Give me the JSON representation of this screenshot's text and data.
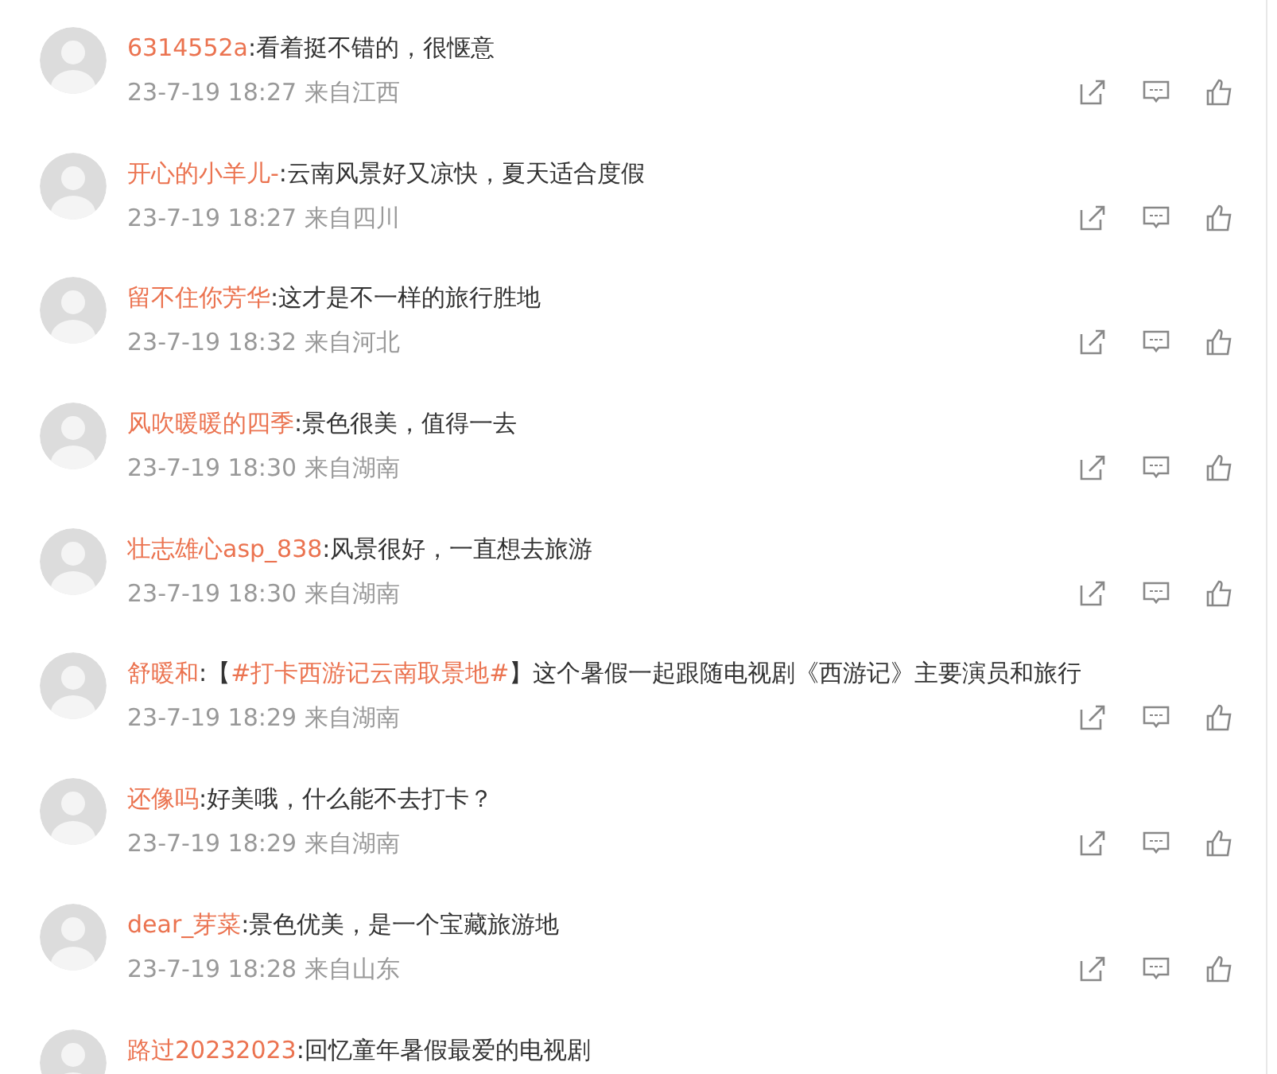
{
  "comments": [
    {
      "user": "6314552a",
      "segments": [
        {
          "text": ":看着挺不错的，很惬意"
        }
      ],
      "time": "23-7-19 18:27",
      "location": "来自江西"
    },
    {
      "user": "开心的小羊儿-",
      "segments": [
        {
          "text": ":云南风景好又凉快，夏天适合度假"
        }
      ],
      "time": "23-7-19 18:27",
      "location": "来自四川"
    },
    {
      "user": "留不住你芳华",
      "segments": [
        {
          "text": ":这才是不一样的旅行胜地"
        }
      ],
      "time": "23-7-19 18:32",
      "location": "来自河北"
    },
    {
      "user": "风吹暖暖的四季",
      "segments": [
        {
          "text": ":景色很美，值得一去"
        }
      ],
      "time": "23-7-19 18:30",
      "location": "来自湖南"
    },
    {
      "user": "壮志雄心asp_838",
      "segments": [
        {
          "text": ":风景很好，一直想去旅游"
        }
      ],
      "time": "23-7-19 18:30",
      "location": "来自湖南"
    },
    {
      "user": "舒暖和",
      "segments": [
        {
          "text": ":【"
        },
        {
          "text": "#打卡西游记云南取景地#",
          "kind": "topic"
        },
        {
          "text": "】这个暑假一起跟随电视剧《西游记》主要演员和旅行"
        }
      ],
      "time": "23-7-19 18:29",
      "location": "来自湖南"
    },
    {
      "user": "还像吗",
      "segments": [
        {
          "text": ":好美哦，什么能不去打卡？"
        }
      ],
      "time": "23-7-19 18:29",
      "location": "来自湖南"
    },
    {
      "user": "dear_芽菜",
      "segments": [
        {
          "text": ":景色优美，是一个宝藏旅游地"
        }
      ],
      "time": "23-7-19 18:28",
      "location": "来自山东"
    },
    {
      "user": "路过20232023",
      "segments": [
        {
          "text": ":回忆童年暑假最爱的电视剧"
        }
      ]
    }
  ]
}
